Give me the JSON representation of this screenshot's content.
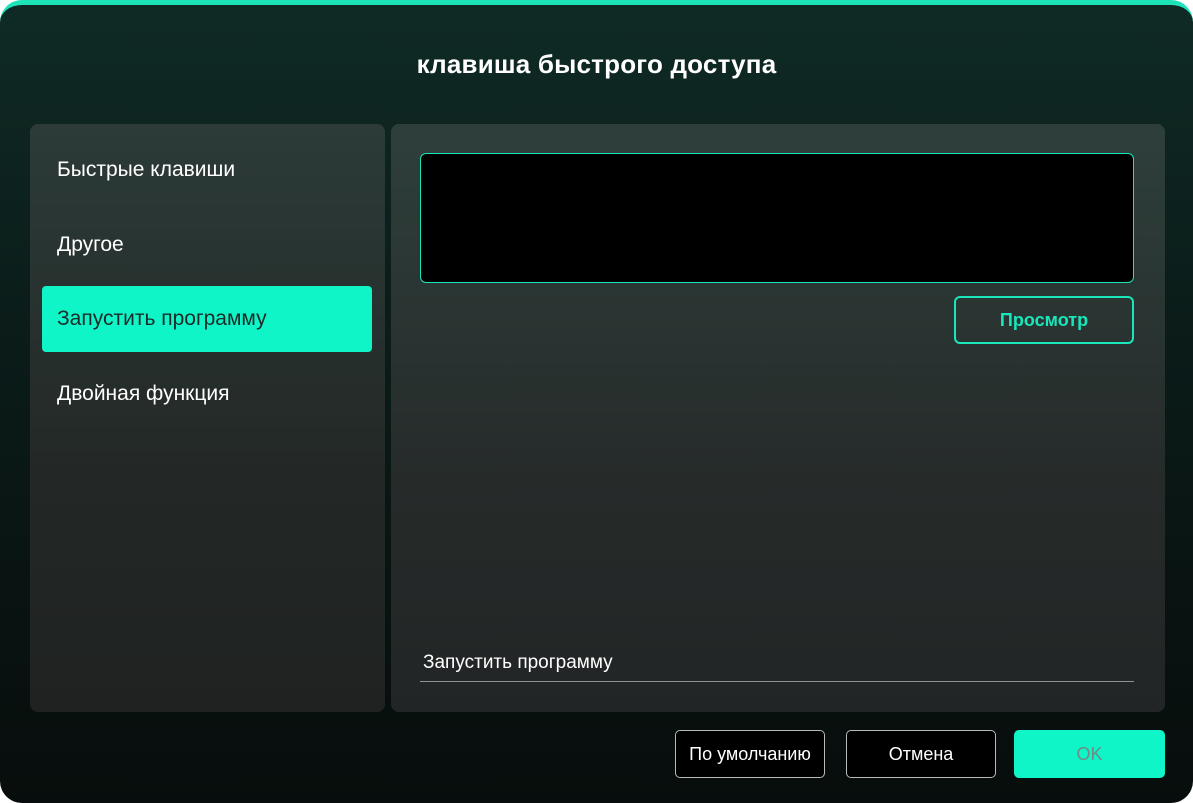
{
  "dialog": {
    "title": "клавиша быстрого доступа"
  },
  "sidebar": {
    "items": [
      {
        "label": "Быстрые клавиши",
        "active": false
      },
      {
        "label": "Другое",
        "active": false
      },
      {
        "label": "Запустить программу",
        "active": true
      },
      {
        "label": "Двойная функция",
        "active": false
      }
    ]
  },
  "content": {
    "program_path_value": "",
    "browse_label": "Просмотр",
    "description_label": "Запустить программу"
  },
  "footer": {
    "default_label": "По умолчанию",
    "cancel_label": "Отмена",
    "ok_label": "OK"
  },
  "colors": {
    "accent": "#10f5c7",
    "background": "#0b1c19",
    "panel": "#2b3533"
  }
}
